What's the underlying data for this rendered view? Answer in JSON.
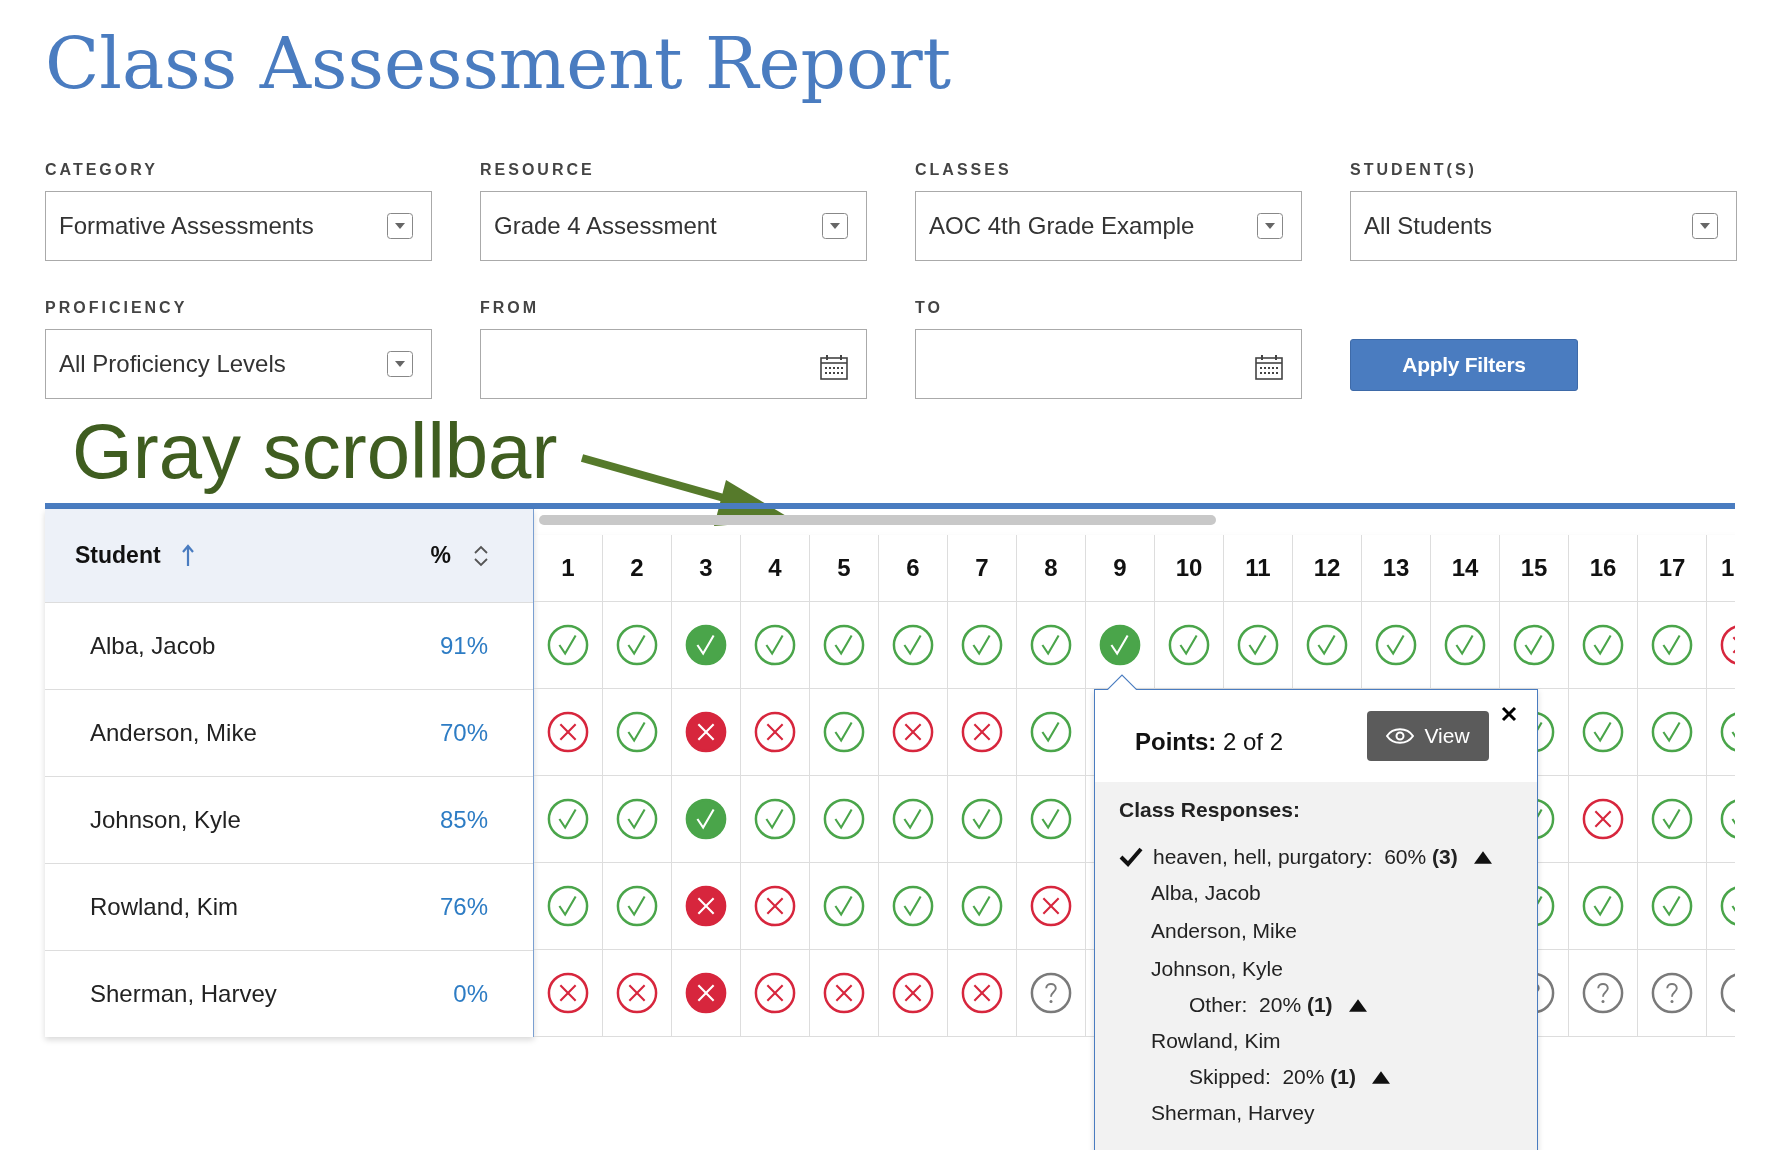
{
  "title": "Class Assessment Report",
  "filters": [
    {
      "label": "CATEGORY",
      "kind": "select",
      "value": "Formative Assessments"
    },
    {
      "label": "RESOURCE",
      "kind": "select",
      "value": "Grade 4 Assessment"
    },
    {
      "label": "CLASSES",
      "kind": "select",
      "value": "AOC 4th Grade Example"
    },
    {
      "label": "STUDENT(S)",
      "kind": "select",
      "value": "All Students"
    },
    {
      "label": "PROFICIENCY",
      "kind": "select",
      "value": "All Proficiency Levels"
    },
    {
      "label": "FROM",
      "kind": "date"
    },
    {
      "label": "TO",
      "kind": "date"
    }
  ],
  "apply_button": "Apply Filters",
  "annotation": "Gray scrollbar",
  "table": {
    "student_header": "Student",
    "percent_header": "%",
    "questions": [
      "1",
      "2",
      "3",
      "4",
      "5",
      "6",
      "7",
      "8",
      "9",
      "10",
      "11",
      "12",
      "13",
      "14",
      "15",
      "16",
      "17",
      "1"
    ],
    "rows": [
      {
        "name": "Alba, Jacob",
        "percent": "91%",
        "results": [
          {
            "kind": "correct",
            "filled": false
          },
          {
            "kind": "correct",
            "filled": false
          },
          {
            "kind": "correct",
            "filled": true
          },
          {
            "kind": "correct",
            "filled": false
          },
          {
            "kind": "correct",
            "filled": false
          },
          {
            "kind": "correct",
            "filled": false
          },
          {
            "kind": "correct",
            "filled": false
          },
          {
            "kind": "correct",
            "filled": false
          },
          {
            "kind": "correct",
            "filled": true
          },
          {
            "kind": "correct",
            "filled": false
          },
          {
            "kind": "correct",
            "filled": false
          },
          {
            "kind": "correct",
            "filled": false
          },
          {
            "kind": "correct",
            "filled": false
          },
          {
            "kind": "correct",
            "filled": false
          },
          {
            "kind": "correct",
            "filled": false
          },
          {
            "kind": "correct",
            "filled": false
          },
          {
            "kind": "correct",
            "filled": false
          },
          {
            "kind": "wrong",
            "filled": false
          }
        ]
      },
      {
        "name": "Anderson, Mike",
        "percent": "70%",
        "results": [
          {
            "kind": "wrong",
            "filled": false
          },
          {
            "kind": "correct",
            "filled": false
          },
          {
            "kind": "wrong",
            "filled": true
          },
          {
            "kind": "wrong",
            "filled": false
          },
          {
            "kind": "correct",
            "filled": false
          },
          {
            "kind": "wrong",
            "filled": false
          },
          {
            "kind": "wrong",
            "filled": false
          },
          {
            "kind": "correct",
            "filled": false
          },
          {
            "kind": "covered"
          },
          {
            "kind": "covered"
          },
          {
            "kind": "covered"
          },
          {
            "kind": "covered"
          },
          {
            "kind": "covered"
          },
          {
            "kind": "covered"
          },
          {
            "kind": "correct",
            "filled": false
          },
          {
            "kind": "correct",
            "filled": false
          },
          {
            "kind": "correct",
            "filled": false
          },
          {
            "kind": "correct",
            "filled": false
          }
        ]
      },
      {
        "name": "Johnson, Kyle",
        "percent": "85%",
        "results": [
          {
            "kind": "correct",
            "filled": false
          },
          {
            "kind": "correct",
            "filled": false
          },
          {
            "kind": "correct",
            "filled": true
          },
          {
            "kind": "correct",
            "filled": false
          },
          {
            "kind": "correct",
            "filled": false
          },
          {
            "kind": "correct",
            "filled": false
          },
          {
            "kind": "correct",
            "filled": false
          },
          {
            "kind": "correct",
            "filled": false
          },
          {
            "kind": "covered"
          },
          {
            "kind": "covered"
          },
          {
            "kind": "covered"
          },
          {
            "kind": "covered"
          },
          {
            "kind": "covered"
          },
          {
            "kind": "covered"
          },
          {
            "kind": "correct",
            "filled": false
          },
          {
            "kind": "wrong",
            "filled": false
          },
          {
            "kind": "correct",
            "filled": false
          },
          {
            "kind": "correct",
            "filled": false
          }
        ]
      },
      {
        "name": "Rowland, Kim",
        "percent": "76%",
        "results": [
          {
            "kind": "correct",
            "filled": false
          },
          {
            "kind": "correct",
            "filled": false
          },
          {
            "kind": "wrong",
            "filled": true
          },
          {
            "kind": "wrong",
            "filled": false
          },
          {
            "kind": "correct",
            "filled": false
          },
          {
            "kind": "correct",
            "filled": false
          },
          {
            "kind": "correct",
            "filled": false
          },
          {
            "kind": "wrong",
            "filled": false
          },
          {
            "kind": "covered"
          },
          {
            "kind": "covered"
          },
          {
            "kind": "covered"
          },
          {
            "kind": "covered"
          },
          {
            "kind": "covered"
          },
          {
            "kind": "covered"
          },
          {
            "kind": "correct",
            "filled": false
          },
          {
            "kind": "correct",
            "filled": false
          },
          {
            "kind": "correct",
            "filled": false
          },
          {
            "kind": "correct",
            "filled": false
          }
        ]
      },
      {
        "name": "Sherman, Harvey",
        "percent": "0%",
        "results": [
          {
            "kind": "wrong",
            "filled": false
          },
          {
            "kind": "wrong",
            "filled": false
          },
          {
            "kind": "wrong",
            "filled": true
          },
          {
            "kind": "wrong",
            "filled": false
          },
          {
            "kind": "wrong",
            "filled": false
          },
          {
            "kind": "wrong",
            "filled": false
          },
          {
            "kind": "wrong",
            "filled": false
          },
          {
            "kind": "unknown",
            "filled": false
          },
          {
            "kind": "covered"
          },
          {
            "kind": "covered"
          },
          {
            "kind": "covered"
          },
          {
            "kind": "covered"
          },
          {
            "kind": "covered"
          },
          {
            "kind": "covered"
          },
          {
            "kind": "unknown",
            "filled": false
          },
          {
            "kind": "unknown",
            "filled": false
          },
          {
            "kind": "unknown",
            "filled": false
          },
          {
            "kind": "unknown",
            "filled": false
          }
        ]
      }
    ]
  },
  "popup": {
    "points": "**Points:** 2 of 2",
    "view_button": "View",
    "heading": "Class Responses:",
    "responses": [
      {
        "text": "heaven, hell, purgatory:  60% **(3)**",
        "correct": true,
        "expanded": true,
        "students": [
          "Alba, Jacob",
          "Anderson, Mike",
          "Johnson, Kyle"
        ]
      },
      {
        "text": "Other:  20% **(1)**",
        "correct": false,
        "expanded": true,
        "students": [
          "Rowland, Kim"
        ]
      },
      {
        "text": "Skipped:  20% **(1)**",
        "correct": false,
        "expanded": true,
        "students": [
          "Sherman, Harvey"
        ]
      }
    ]
  }
}
